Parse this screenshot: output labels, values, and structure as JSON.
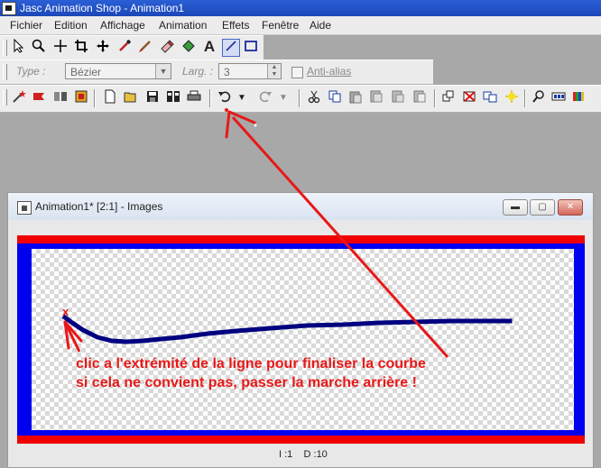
{
  "window": {
    "title": "Jasc Animation Shop - Animation1"
  },
  "menu": [
    "Fichier",
    "Edition",
    "Affichage",
    "Animation",
    "Effets",
    "Fenêtre",
    "Aide"
  ],
  "tool_palette": {
    "icons": [
      "select-arrow-icon",
      "zoom-icon",
      "crosshair-icon",
      "crop-icon",
      "move-icon",
      "dropper-icon",
      "brush-icon",
      "eraser-icon",
      "fill-icon",
      "text-icon",
      "line-icon",
      "rectangle-icon"
    ],
    "active": "line-icon",
    "text_tool_glyph": "A"
  },
  "line_options": {
    "type_label": "Type :",
    "type_value": "Bézier",
    "width_label": "Larg. :",
    "width_value": "3",
    "antialias_label": "Anti-alias"
  },
  "main_toolbar": {
    "icons": [
      "wizard-icon",
      "banner-icon",
      "optimize-icon",
      "film-icon",
      "new-file-icon",
      "open-folder-icon",
      "save-icon",
      "save-frames-icon",
      "print-icon",
      "undo-icon",
      "undo-dropdown-icon",
      "redo-icon",
      "redo-dropdown-icon",
      "cut-icon",
      "copy-icon",
      "paste-icon",
      "paste-frame-icon",
      "paste-after-icon",
      "transition-icon",
      "delete-frame-icon",
      "duplicate-icon",
      "effect-icon",
      "find-icon",
      "frames-view-icon",
      "colors-icon"
    ]
  },
  "child_window": {
    "title": "Animation1* [2:1] - Images",
    "status": "I :1    D :10"
  },
  "annotation": {
    "marker": "x",
    "line1": "clic a l'extrémité de la ligne pour finaliser la courbe",
    "line2": "si cela ne convient pas, passer la marche arrière !"
  },
  "colors": {
    "canvas_border_blue": "#0000f0",
    "canvas_border_red": "#f00000",
    "curve": "#000080",
    "annotation": "#e81818"
  }
}
